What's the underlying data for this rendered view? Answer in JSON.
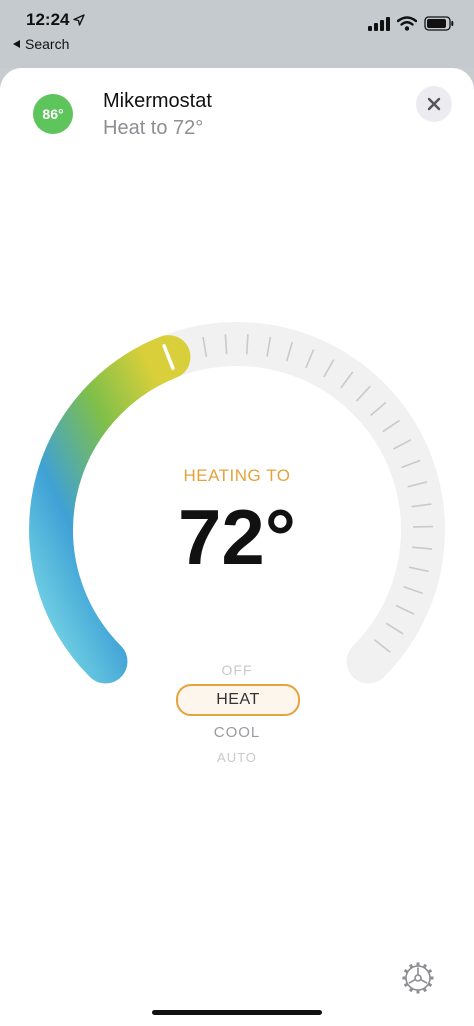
{
  "status_bar": {
    "time": "12:24",
    "back_label": "Search"
  },
  "header": {
    "current_temp": "86°",
    "device_name": "Mikermostat",
    "device_status": "Heat to 72°"
  },
  "dial": {
    "heading": "HEATING TO",
    "setpoint": "72°",
    "setpoint_fraction": 0.42
  },
  "modes": {
    "off": "OFF",
    "heat": "HEAT",
    "cool": "COOL",
    "auto": "AUTO",
    "selected": "HEAT"
  },
  "colors": {
    "heat_accent": "#e6a23c",
    "badge_green": "#5ec45c",
    "gradient_start": "#7ad9e6",
    "gradient_mid": "#3fa1d6",
    "gradient_green": "#7fbf4a",
    "gradient_end": "#d8cf3a"
  },
  "icons": {
    "location": "location-arrow-icon",
    "back": "back-triangle-icon",
    "signal": "cellular-signal-icon",
    "wifi": "wifi-icon",
    "battery": "battery-icon",
    "close": "close-icon",
    "settings": "gear-icon"
  }
}
